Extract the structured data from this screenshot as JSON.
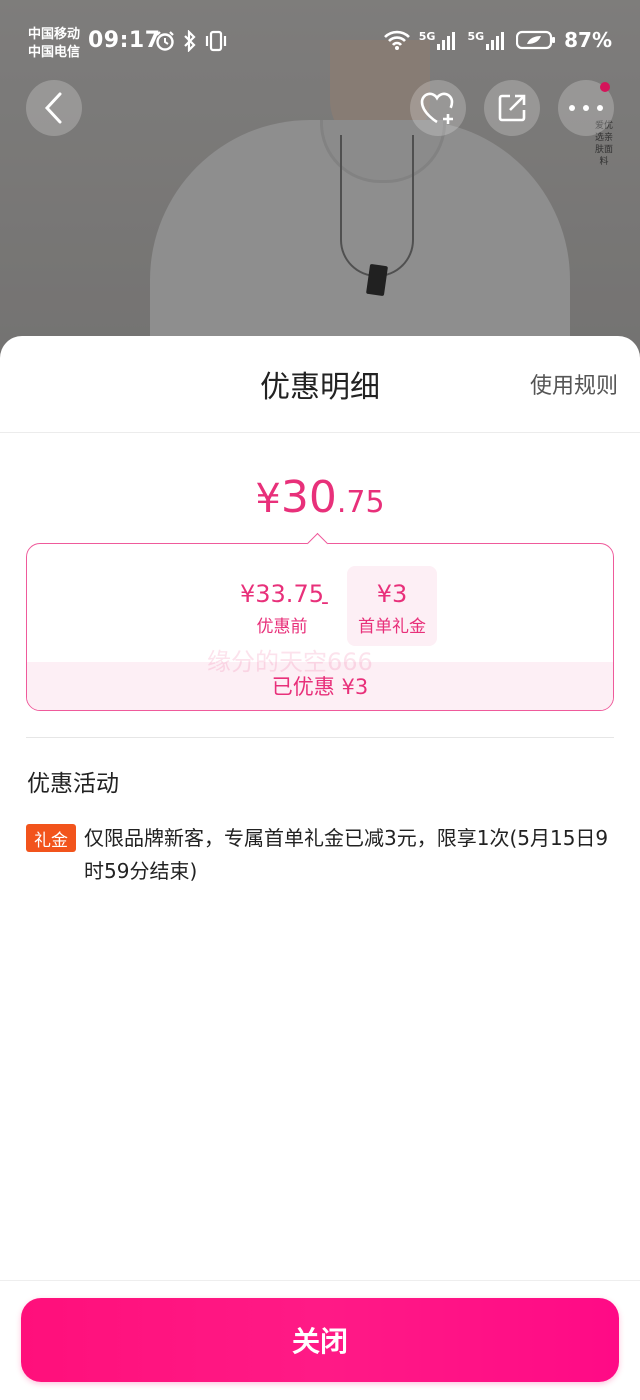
{
  "status_bar": {
    "carrier_1": "中国移动",
    "carrier_2": "中国电信",
    "time": "09:17",
    "signal_label_1": "5G",
    "signal_label_2": "5G",
    "battery": "87%"
  },
  "background": {
    "side_text": "爱优选亲肤面料"
  },
  "sheet": {
    "title": "优惠明细",
    "rules_link": "使用规则",
    "price": {
      "symbol": "¥",
      "integer": "30",
      "decimal": ".75"
    },
    "breakdown": {
      "before_amount": "¥33.75",
      "before_label": "优惠前",
      "operator": "-",
      "gift_amount": "¥3",
      "gift_label": "首单礼金",
      "saved_text": "已优惠 ¥3",
      "watermark": "缘分的天空666"
    },
    "section_title": "优惠活动",
    "activity": {
      "tag": "礼金",
      "text": "仅限品牌新客，专属首单礼金已减3元，限享1次(5月15日9时59分结束)"
    },
    "close_button": "关闭"
  },
  "colors": {
    "accent": "#e8307a",
    "tag": "#f2541c",
    "button": "#ff1a86"
  }
}
